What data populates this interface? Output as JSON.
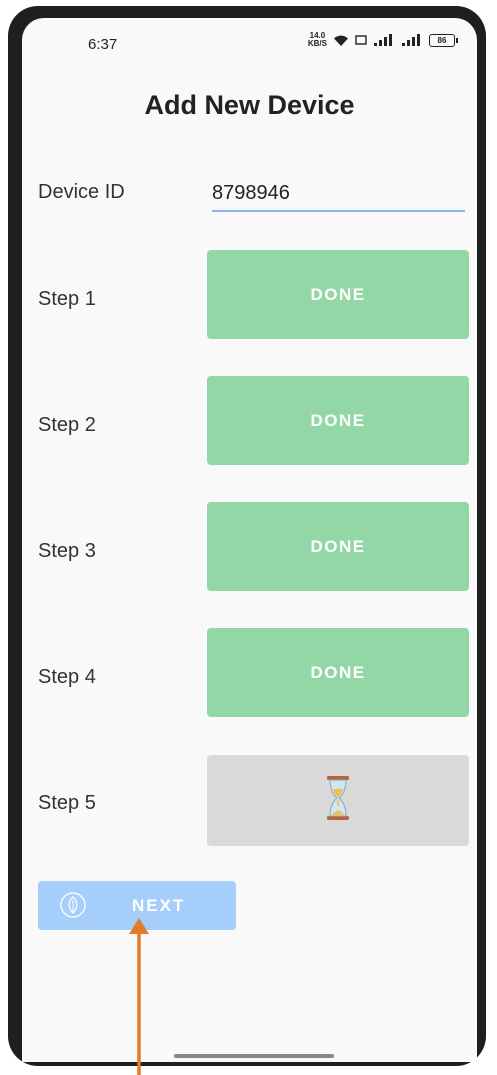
{
  "status_bar": {
    "time": "6:37",
    "net_speed_value": "14.0",
    "net_speed_unit": "KB/S",
    "battery": "86"
  },
  "title": "Add New Device",
  "device": {
    "label": "Device ID",
    "value": "8798946"
  },
  "steps": [
    {
      "label": "Step 1",
      "status": "DONE"
    },
    {
      "label": "Step 2",
      "status": "DONE"
    },
    {
      "label": "Step 3",
      "status": "DONE"
    },
    {
      "label": "Step 4",
      "status": "DONE"
    },
    {
      "label": "Step 5",
      "status_icon": "hourglass-icon"
    }
  ],
  "next_button": {
    "label": "NEXT",
    "icon": "leaf-icon"
  },
  "colors": {
    "done": "#93d7a7",
    "pending": "#d9d9d9",
    "next": "#a6cefa",
    "arrow": "#e07b2b"
  }
}
